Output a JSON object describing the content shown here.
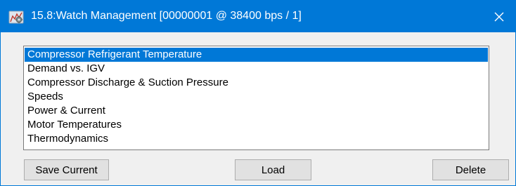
{
  "window": {
    "title": "15.8:Watch Management [00000001 @ 38400 bps / 1]",
    "icon": "app-gear-icon",
    "close_icon": "close-icon"
  },
  "list": {
    "items": [
      {
        "label": "Compressor Refrigerant Temperature",
        "selected": true
      },
      {
        "label": "Demand vs. IGV",
        "selected": false
      },
      {
        "label": "Compressor Discharge & Suction Pressure",
        "selected": false
      },
      {
        "label": "Speeds",
        "selected": false
      },
      {
        "label": "Power & Current",
        "selected": false
      },
      {
        "label": "Motor Temperatures",
        "selected": false
      },
      {
        "label": "Thermodynamics",
        "selected": false
      }
    ]
  },
  "buttons": {
    "save_label": "Save Current",
    "load_label": "Load",
    "delete_label": "Delete"
  },
  "colors": {
    "titlebar": "#0078d7",
    "selection": "#0078d7",
    "window_bg": "#f0f0f0"
  }
}
